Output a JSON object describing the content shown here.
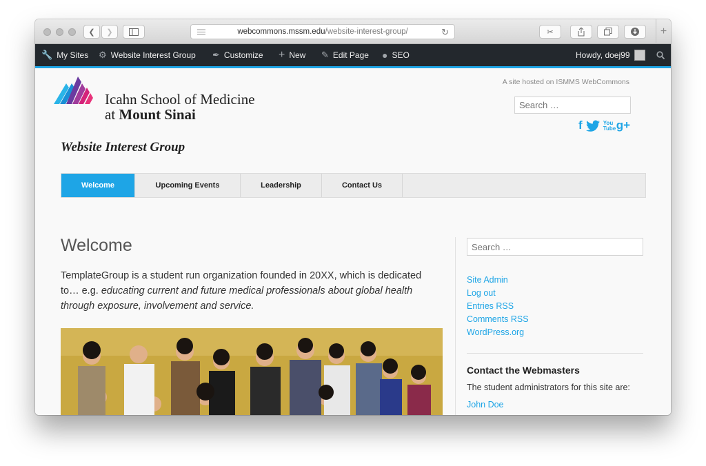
{
  "browser": {
    "url_host": "webcommons.mssm.edu",
    "url_path": "/website-interest-group/"
  },
  "adminbar": {
    "my_sites": "My Sites",
    "site_name": "Website Interest Group",
    "customize": "Customize",
    "new": "New",
    "edit_page": "Edit Page",
    "seo": "SEO",
    "howdy": "Howdy, doej99"
  },
  "header": {
    "logo_line1": "Icahn School of Medicine",
    "logo_line2_prefix": "at ",
    "logo_line2_bold": "Mount Sinai",
    "hosted_text": "A site hosted on ISMMS WebCommons",
    "search_placeholder": "Search …",
    "site_title": "Website Interest Group",
    "social": [
      "f",
      "t",
      "You Tube",
      "g+"
    ]
  },
  "nav": {
    "tabs": [
      "Welcome",
      "Upcoming Events",
      "Leadership",
      "Contact Us"
    ]
  },
  "main": {
    "title": "Welcome",
    "intro_plain": "TemplateGroup is a student run organization founded in 20XX, which is dedicated to… e.g. ",
    "intro_italic": "educating current and future medical professionals about global health through exposure, involvement and service."
  },
  "sidebar": {
    "search_placeholder": "Search …",
    "links": [
      "Site Admin",
      "Log out",
      "Entries RSS",
      "Comments RSS",
      "WordPress.org"
    ],
    "contact_title": "Contact the Webmasters",
    "contact_text": "The student administrators for this site are:",
    "contact_name": "John Doe"
  },
  "colors": {
    "accent": "#1ea5e6",
    "adminbar": "#23282d"
  }
}
